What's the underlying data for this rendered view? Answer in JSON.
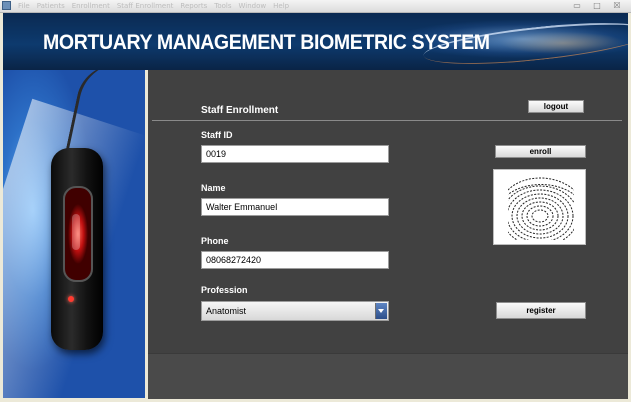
{
  "window": {
    "menu": [
      "File",
      "Patients",
      "Enrollment",
      "Staff Enrollment",
      "Reports",
      "Tools",
      "Window",
      "Help"
    ],
    "controls": {
      "minimize": "▭",
      "maximize": "□",
      "close": "☒"
    }
  },
  "banner": {
    "title": "MORTUARY MANAGEMENT BIOMETRIC SYSTEM"
  },
  "form": {
    "section_title": "Staff Enrollment",
    "logout_label": "logout",
    "enroll_label": "enroll",
    "register_label": "register",
    "staff_id": {
      "label": "Staff ID",
      "value": "0019"
    },
    "name": {
      "label": "Name",
      "value": "Walter Emmanuel"
    },
    "phone": {
      "label": "Phone",
      "value": "08068272420"
    },
    "profession": {
      "label": "Profession",
      "selected": "Anatomist"
    }
  },
  "icons": {
    "app": "app-icon",
    "scanner": "fingerprint-scanner-image",
    "fingerprint": "fingerprint-icon",
    "dropdown": "chevron-down-icon"
  }
}
